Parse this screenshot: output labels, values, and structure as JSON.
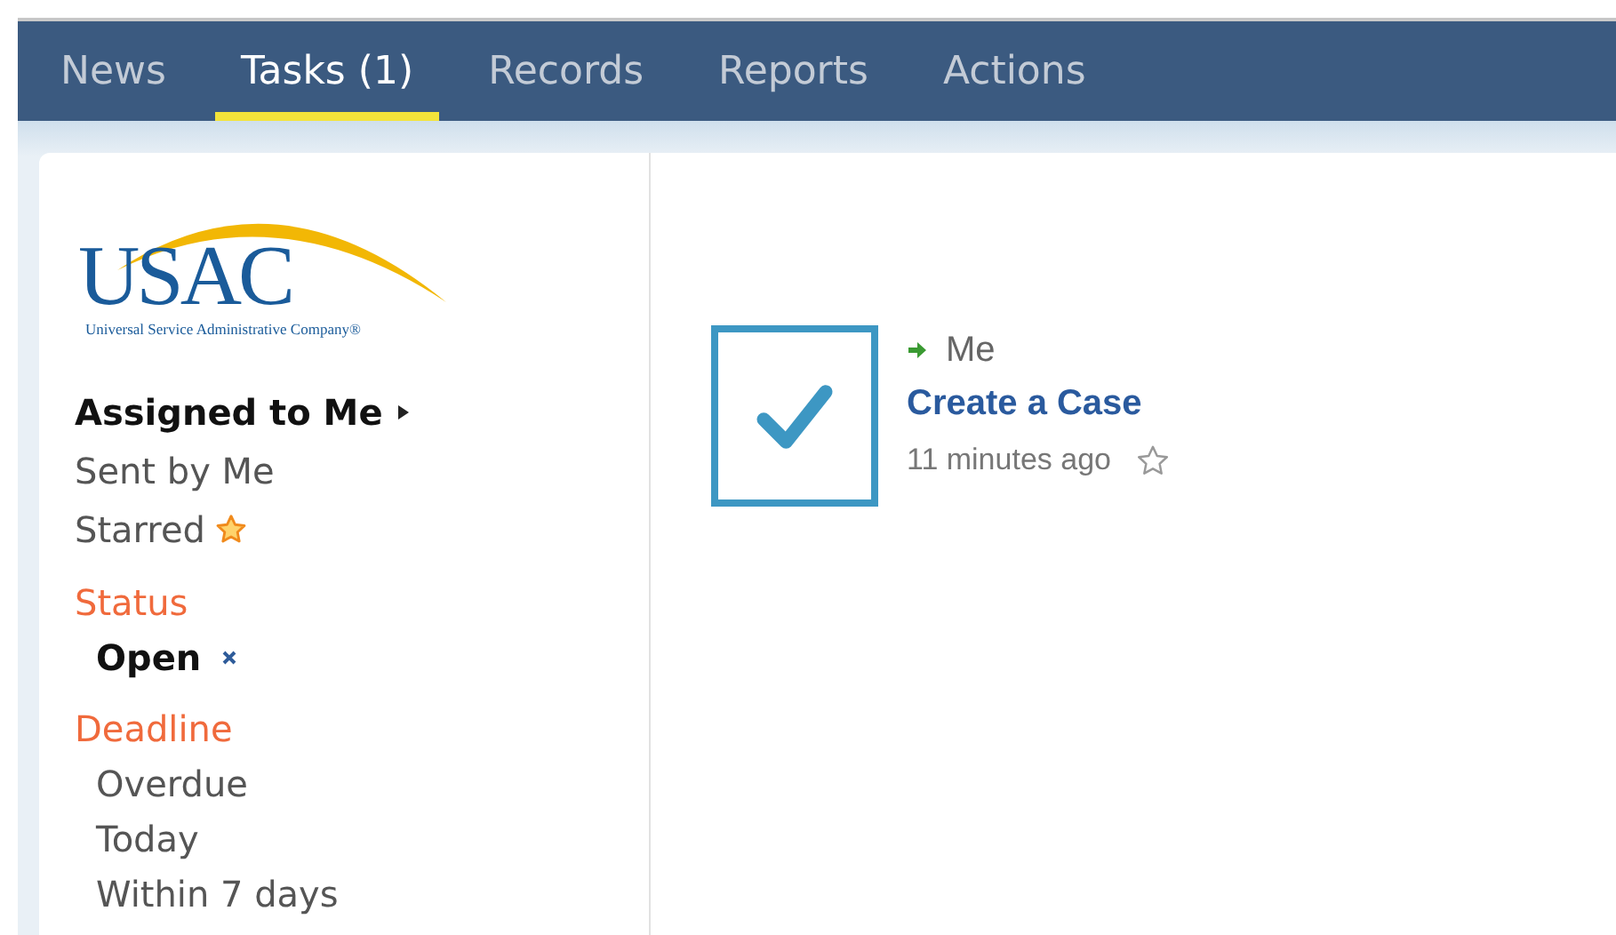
{
  "nav": {
    "tabs": [
      {
        "label": "News",
        "selected": false
      },
      {
        "label": "Tasks (1)",
        "selected": true
      },
      {
        "label": "Records",
        "selected": false
      },
      {
        "label": "Reports",
        "selected": false
      },
      {
        "label": "Actions",
        "selected": false
      }
    ]
  },
  "logo": {
    "name": "USAC",
    "tagline": "Universal Service Administrative Company®"
  },
  "sidebar": {
    "items": [
      {
        "label": "Assigned to Me",
        "selected": true,
        "kind": "plain"
      },
      {
        "label": "Sent by Me",
        "selected": false,
        "kind": "plain"
      },
      {
        "label": "Starred",
        "selected": false,
        "kind": "starred"
      }
    ],
    "filters": [
      {
        "title": "Status",
        "options": [
          {
            "label": "Open",
            "selected": true
          }
        ]
      },
      {
        "title": "Deadline",
        "options": [
          {
            "label": "Overdue",
            "selected": false
          },
          {
            "label": "Today",
            "selected": false
          },
          {
            "label": "Within 7 days",
            "selected": false
          }
        ]
      }
    ]
  },
  "tasks": [
    {
      "checked": true,
      "assignee": "Me",
      "title": "Create a Case",
      "time": "11 minutes ago",
      "starred": false
    }
  ]
}
